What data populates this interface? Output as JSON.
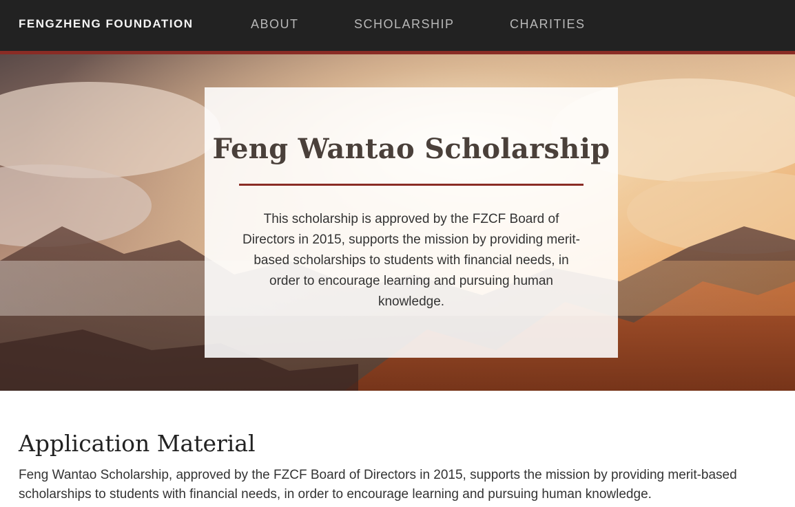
{
  "navbar": {
    "brand": "FENGZHENG FOUNDATION",
    "links": [
      {
        "label": "ABOUT"
      },
      {
        "label": "SCHOLARSHIP"
      },
      {
        "label": "CHARITIES"
      }
    ],
    "background_color": "#222222",
    "accent_color": "#8a2c25"
  },
  "hero": {
    "title": "Feng Wantao Scholarship",
    "description": "This scholarship is approved by the FZCF Board of Directors in 2015, supports the mission by providing merit-based scholarships to students with financial needs, in order to encourage learning and pursuing human knowledge.",
    "background_image": "sunset-mountains-clouds"
  },
  "content": {
    "section_title": "Application Material",
    "section_body": "Feng Wantao Scholarship, approved by the FZCF Board of Directors in 2015, supports the mission by providing merit-based scholarships to students with financial needs, in order to encourage learning and pursuing human knowledge."
  }
}
